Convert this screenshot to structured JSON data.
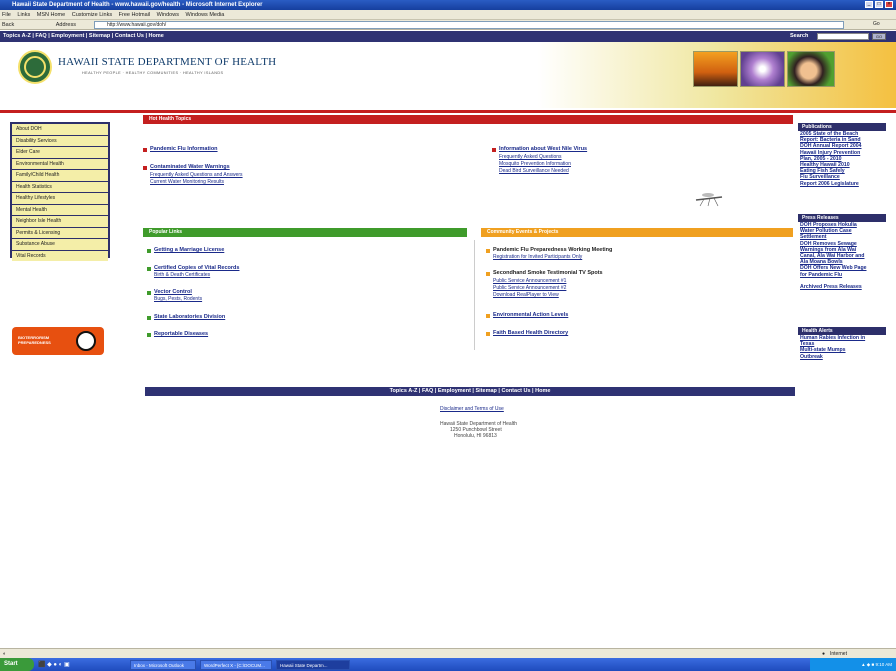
{
  "window": {
    "title": "Hawaii State Department of Health - www.hawaii.gov/health - Microsoft Internet Explorer"
  },
  "menubar": {
    "items": [
      "File",
      "Links",
      "MSN Home",
      "Customize Links",
      "Free Hotmail",
      "Windows",
      "Windows Media"
    ]
  },
  "addressbar": {
    "back": "Back",
    "address_label": "Address",
    "url": "http://www.hawaii.gov/doh/",
    "go": "Go"
  },
  "topnav": {
    "links": "Topics A-Z | FAQ | Employment | Sitemap | Contact Us | Home",
    "search_label": "Search",
    "search_button": "GO"
  },
  "header": {
    "org_name": "HAWAII STATE DEPARTMENT OF HEALTH",
    "tagline": "HEALTHY PEOPLE · HEALTHY COMMUNITIES · HEALTHY ISLANDS"
  },
  "leftnav": {
    "items": [
      "About DOH",
      "Disability Services",
      "Elder Care",
      "Environmental Health",
      "Family/Child Health",
      "Health Statistics",
      "Healthy Lifestyles",
      "Mental Health",
      "Neighbor Isle Health",
      "Permits & Licensing",
      "Substance Abuse",
      "Vital Records"
    ]
  },
  "bioterrorism": {
    "label_line1": "BIOTERRORISM",
    "label_line2": "PREPAREDNESS"
  },
  "hot_topics": {
    "heading": "Hot Health Topics",
    "items": [
      {
        "title": "Pandemic Flu Information",
        "subs": []
      },
      {
        "title": "Contaminated Water Warnings",
        "subs": [
          "Frequently Asked Questions and Answers",
          "Current Water Monitoring Results"
        ]
      }
    ],
    "west_nile": {
      "title": "Information about West Nile Virus",
      "subs": [
        "Frequently Asked Questions",
        "Mosquito Prevention Information",
        "Dead Bird Surveillance Needed"
      ]
    }
  },
  "popular_links": {
    "heading": "Popular Links",
    "items": [
      {
        "title": "Getting a Marriage License",
        "subs": []
      },
      {
        "title": "Certified Copies of Vital Records",
        "subs": [
          "Birth & Death Certificates"
        ]
      },
      {
        "title": "Vector Control",
        "subs": [
          "Bugs, Pests, Rodents"
        ]
      },
      {
        "title": "State Laboratories Division",
        "subs": []
      },
      {
        "title": "Reportable Diseases",
        "subs": []
      }
    ]
  },
  "community_events": {
    "heading": "Community Events & Projects",
    "items": [
      {
        "title": "Pandemic Flu Preparedness Working Meeting",
        "subs": [
          "Registration for Invited Participants Only"
        ]
      },
      {
        "title": "Secondhand Smoke Testimonial TV Spots",
        "subs": [
          "Public Service Announcement #1",
          "Public Service Announcement #2",
          "Download RealPlayer to View"
        ]
      },
      {
        "title": "Environmental Action Levels",
        "subs": []
      },
      {
        "title": "Faith Based Health Directory",
        "subs": []
      }
    ]
  },
  "publications": {
    "heading": "Publications",
    "lines": [
      "2005 State of the Beach",
      "Report: Bacteria in Sand",
      "DOH Annual Report 2004",
      "Hawaii Injury Prevention",
      "Plan, 2005 - 2010",
      "Healthy Hawaii 2010",
      "Eating Fish Safely",
      "Flu Surveillance",
      "Report 2006 Legislature"
    ]
  },
  "press_releases": {
    "heading": "Press Releases",
    "lines": [
      "DOH Proposes Hokulia",
      "Water Pollution Case",
      "Settlement",
      "DOH Removes Sewage",
      "Warnings from Ala Wai",
      "Canal, Ala Wai Harbor and",
      "Ala Moana Bowls",
      "DOH Offers New Web Page",
      "for Pandemic Flu",
      "",
      "Archived Press Releases"
    ]
  },
  "health_alerts": {
    "heading": "Health Alerts",
    "lines": [
      "Human Rabies Infection in",
      "Texas",
      "Multi-state Mumps",
      "Outbreak"
    ]
  },
  "footer": {
    "links": "Topics A-Z | FAQ | Employment | Sitemap | Contact Us | Home",
    "disclaimer": "Disclaimer and Terms of Use",
    "address_lines": [
      "Hawaii State Department of Health",
      "1250 Punchbowl Street",
      "Honolulu, HI 96813"
    ]
  },
  "statusbar": {
    "zone": "Internet"
  },
  "taskbar": {
    "start": "Start",
    "items": [
      "Inbox - Microsoft Outlook",
      "WordPerfect X - [C:\\DOCUM...",
      "Hawaii State Departm..."
    ],
    "clock": "9:10 AM"
  },
  "colors": {
    "navy": "#2f3273",
    "hot_red": "#c41f1f",
    "popular_green": "#3f9b2b",
    "community_orange": "#f0a020"
  }
}
